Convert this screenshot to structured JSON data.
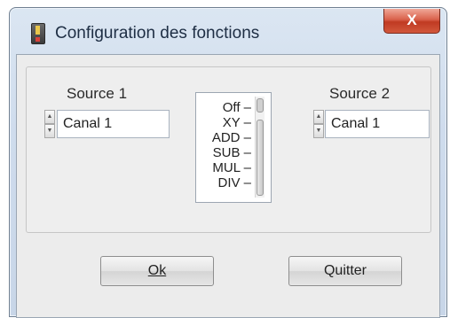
{
  "window": {
    "title": "Configuration des fonctions",
    "close_label": "X"
  },
  "source1": {
    "label": "Source 1",
    "value": "Canal 1"
  },
  "source2": {
    "label": "Source 2",
    "value": "Canal 1"
  },
  "function_list": {
    "items": [
      "Off –",
      "XY –",
      "ADD –",
      "SUB –",
      "MUL –",
      "DIV –"
    ]
  },
  "buttons": {
    "ok_label": "Ok",
    "quit_label": "Quitter"
  }
}
